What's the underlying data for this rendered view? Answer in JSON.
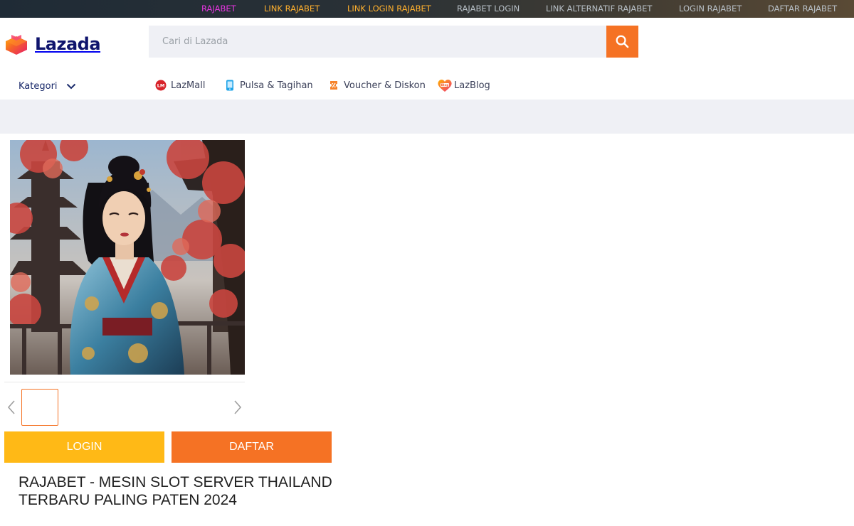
{
  "top_links": [
    {
      "label": "RAJABET",
      "style": "accent-pink"
    },
    {
      "label": "LINK RAJABET",
      "style": "accent-orange"
    },
    {
      "label": "LINK LOGIN RAJABET",
      "style": "accent-orange"
    },
    {
      "label": "RAJABET LOGIN",
      "style": "muted"
    },
    {
      "label": "LINK ALTERNATIF RAJABET",
      "style": "muted"
    },
    {
      "label": "LOGIN RAJABET",
      "style": "muted"
    },
    {
      "label": "DAFTAR RAJABET",
      "style": "muted"
    }
  ],
  "header": {
    "logo_text": "Lazada",
    "search": {
      "placeholder": "Cari di Lazada",
      "value": ""
    },
    "search_button_icon": "search-icon"
  },
  "nav": {
    "kategori_label": "Kategori",
    "items": [
      {
        "label": "LazMall",
        "icon": "lazmall-icon"
      },
      {
        "label": "Pulsa & Tagihan",
        "icon": "phone-icon"
      },
      {
        "label": "Voucher & Diskon",
        "icon": "voucher-icon"
      },
      {
        "label": "LazBlog",
        "icon": "lazblog-icon"
      }
    ]
  },
  "buttons": {
    "login": "LOGIN",
    "daftar": "DAFTAR"
  },
  "product": {
    "title": "RAJABET - MESIN SLOT SERVER THAILAND TERBARU PALING PATEN 2024"
  },
  "colors": {
    "brand_orange": "#f57224",
    "login_yellow": "#ffb916",
    "logo_navy": "#0f146d",
    "search_bg": "#eff0f5",
    "topbar_pink": "#e636e0",
    "topbar_orange": "#ffb02e"
  }
}
